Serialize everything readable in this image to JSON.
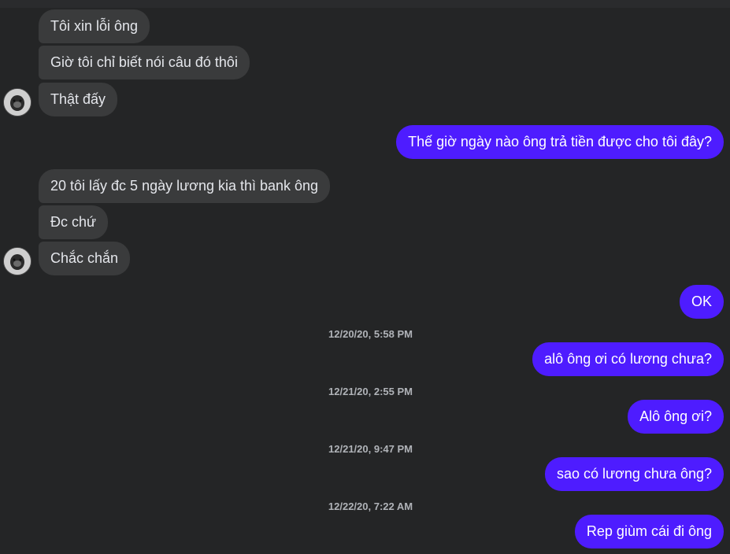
{
  "messages": {
    "m1": "Tôi xin lỗi ông",
    "m2": "Giờ tôi chỉ biết nói câu đó thôi",
    "m3": "Thật đấy",
    "m4": "Thế giờ ngày nào ông trả tiền được cho tôi đây?",
    "m5": "20 tôi lấy đc 5 ngày lương kia thì bank ông",
    "m6": "Đc chứ",
    "m7": "Chắc chắn",
    "m8": "OK",
    "m9": "alô ông ơi có lương chưa?",
    "m10": "Alô ông ơi?",
    "m11": "sao có lương chưa ông?",
    "m12": "Rep giùm cái đi ông"
  },
  "timestamps": {
    "t1": "12/20/20, 5:58 PM",
    "t2": "12/21/20, 2:55 PM",
    "t3": "12/21/20, 9:47 PM",
    "t4": "12/22/20, 7:22 AM"
  },
  "colors": {
    "background": "#242526",
    "incoming_bubble": "#3a3b3c",
    "outgoing_bubble": "#4e1cff",
    "timestamp_text": "#b0b3b8"
  },
  "icons": {
    "avatar": "contact-avatar"
  }
}
